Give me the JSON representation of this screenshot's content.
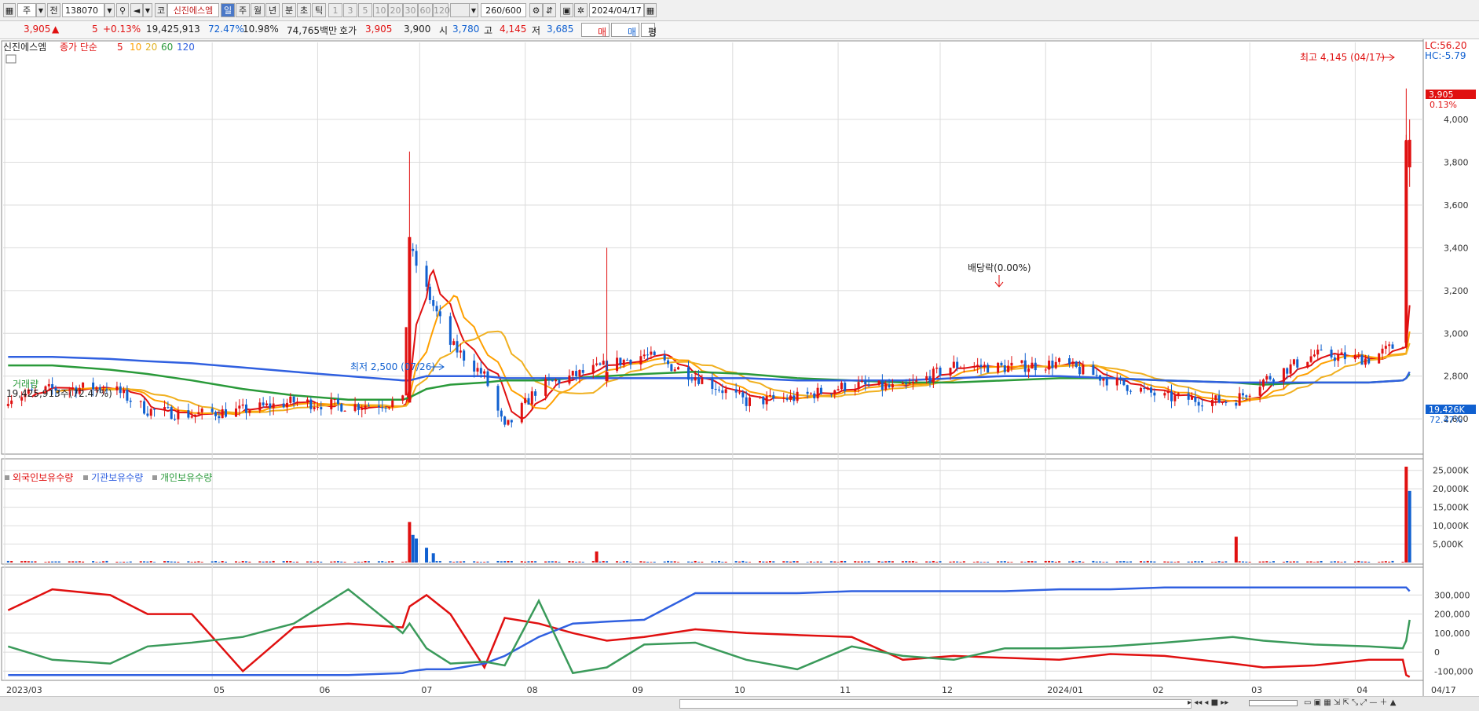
{
  "toolbar": {
    "market_label": "주",
    "prefix_label": "전",
    "code_value": "138070",
    "company_prefix": "코",
    "company_name": "신진에스엠",
    "periods": [
      "일",
      "주",
      "월",
      "년",
      "분",
      "초",
      "틱"
    ],
    "intervals": [
      "1",
      "3",
      "5",
      "10",
      "20",
      "30",
      "60",
      "120"
    ],
    "count_value": "260",
    "count_total": "/600",
    "date_value": "2024/04/17"
  },
  "quote": {
    "price": "3,905",
    "change": "5",
    "change_pct": "+0.13%",
    "volume": "19,425,913",
    "vol_ratio": "72.47%",
    "turnover": "10.98%",
    "amount": "74,765백만",
    "ask_label": "호가",
    "ask_value": "3,905",
    "bid_value": "3,900",
    "open_label": "시",
    "open_value": "3,780",
    "high_label": "고",
    "high_value": "4,145",
    "low_label": "저",
    "low_value": "3,685",
    "buy_label": "매수",
    "sell_label": "매도",
    "extra_label": "평"
  },
  "colors": {
    "up": "#e01010",
    "down": "#1060d0",
    "ma5": "#e01010",
    "ma10": "#ffa000",
    "ma20": "#f0b020",
    "ma60": "#2a9a3a",
    "ma120": "#3060e0",
    "foreign": "#e01010",
    "institution": "#3060e0",
    "individual": "#3a9a5a"
  },
  "chart_data": [
    {
      "type": "candlestick",
      "title": "신진에스엠",
      "legend": [
        "종가 단순",
        "5",
        "10",
        "20",
        "60",
        "120"
      ],
      "ylim": [
        2450,
        4250
      ],
      "y_ticks": [
        "4,000",
        "3,800",
        "3,600",
        "3,400",
        "3,200",
        "3,000",
        "2,800",
        "2,600"
      ],
      "x_ticks": [
        "2023/03",
        "05",
        "06",
        "07",
        "08",
        "09",
        "10",
        "11",
        "12",
        "2024/01",
        "02",
        "03",
        "04",
        "04/17"
      ],
      "last_price_label": "3,905",
      "last_pct_label": "0.13%",
      "lc_label": "LC:56.20",
      "hc_label": "HC:-5.79",
      "high_annotation": "최고 4,145 (04/17)",
      "low_annotation": "최저 2,500 (07/26)",
      "dividend_annotation": "배당락(0.00%)",
      "close_series": [
        {
          "x": "2023-03-02",
          "close": 2700
        },
        {
          "x": "2023-03-15",
          "close": 2740
        },
        {
          "x": "2023-04-01",
          "close": 2750
        },
        {
          "x": "2023-04-12",
          "close": 2640
        },
        {
          "x": "2023-04-25",
          "close": 2620
        },
        {
          "x": "2023-05-10",
          "close": 2640
        },
        {
          "x": "2023-05-25",
          "close": 2680
        },
        {
          "x": "2023-06-10",
          "close": 2660
        },
        {
          "x": "2023-06-26",
          "close": 2680
        },
        {
          "x": "2023-06-28",
          "close": 3400
        },
        {
          "x": "2023-07-03",
          "close": 3200
        },
        {
          "x": "2023-07-10",
          "close": 2950
        },
        {
          "x": "2023-07-20",
          "close": 2800
        },
        {
          "x": "2023-07-26",
          "close": 2550
        },
        {
          "x": "2023-08-05",
          "close": 2750
        },
        {
          "x": "2023-08-15",
          "close": 2800
        },
        {
          "x": "2023-08-25",
          "close": 2850
        },
        {
          "x": "2023-09-05",
          "close": 2900
        },
        {
          "x": "2023-09-20",
          "close": 2800
        },
        {
          "x": "2023-10-05",
          "close": 2680
        },
        {
          "x": "2023-10-20",
          "close": 2700
        },
        {
          "x": "2023-11-05",
          "close": 2760
        },
        {
          "x": "2023-11-20",
          "close": 2740
        },
        {
          "x": "2023-12-05",
          "close": 2850
        },
        {
          "x": "2023-12-20",
          "close": 2840
        },
        {
          "x": "2024-01-05",
          "close": 2860
        },
        {
          "x": "2024-01-20",
          "close": 2780
        },
        {
          "x": "2024-02-05",
          "close": 2700
        },
        {
          "x": "2024-02-25",
          "close": 2680
        },
        {
          "x": "2024-03-05",
          "close": 2780
        },
        {
          "x": "2024-03-20",
          "close": 2900
        },
        {
          "x": "2024-04-05",
          "close": 2880
        },
        {
          "x": "2024-04-15",
          "close": 2960
        },
        {
          "x": "2024-04-16",
          "close": 3900
        },
        {
          "x": "2024-04-17",
          "close": 3905
        }
      ],
      "ma120": [
        2890,
        2890,
        2880,
        2870,
        2860,
        2840,
        2820,
        2800,
        2780,
        2780,
        2800,
        2800,
        2800,
        2790,
        2790,
        2790,
        2790,
        2790,
        2790,
        2790,
        2780,
        2780,
        2780,
        2790,
        2800,
        2800,
        2790,
        2780,
        2770,
        2770,
        2770,
        2770,
        2780,
        2790,
        2820
      ],
      "ma60": [
        2850,
        2850,
        2830,
        2810,
        2780,
        2740,
        2710,
        2690,
        2690,
        2700,
        2740,
        2760,
        2770,
        2780,
        2780,
        2790,
        2800,
        2810,
        2820,
        2810,
        2790,
        2780,
        2770,
        2770,
        2780,
        2790,
        2790,
        2780,
        2770,
        2760,
        2770,
        2770,
        2780,
        2790,
        2810
      ]
    },
    {
      "type": "bar",
      "title": "거래량",
      "summary_label": "19,425,913주(72.47%)",
      "ylim": [
        0,
        26000
      ],
      "y_ticks": [
        "25,000K",
        "20,000K",
        "15,000K",
        "10,000K",
        "5,000K"
      ],
      "last_label": "19,426K",
      "last_pct_label": "72.47%",
      "spikes": [
        {
          "x": "2023-06-28",
          "value": 11000,
          "dir": "up"
        },
        {
          "x": "2023-06-29",
          "value": 7500,
          "dir": "down"
        },
        {
          "x": "2023-06-30",
          "value": 6500,
          "dir": "down"
        },
        {
          "x": "2023-07-03",
          "value": 4000,
          "dir": "down"
        },
        {
          "x": "2023-07-05",
          "value": 2500,
          "dir": "down"
        },
        {
          "x": "2023-08-22",
          "value": 3000,
          "dir": "up"
        },
        {
          "x": "2024-02-26",
          "value": 7000,
          "dir": "up"
        },
        {
          "x": "2024-04-16",
          "value": 26000,
          "dir": "up"
        },
        {
          "x": "2024-04-17",
          "value": 19426,
          "dir": "down"
        }
      ]
    },
    {
      "type": "line",
      "legend": [
        "외국인보유수량",
        "기관보유수량",
        "개인보유수량"
      ],
      "ylim": [
        -140000,
        380000
      ],
      "y_ticks": [
        "300,000",
        "200,000",
        "100,000",
        "0",
        "-100,000"
      ],
      "series": [
        {
          "name": "외국인보유수량",
          "values": [
            220000,
            330000,
            300000,
            200000,
            200000,
            -100000,
            130000,
            150000,
            130000,
            240000,
            300000,
            200000,
            -80000,
            180000,
            150000,
            100000,
            60000,
            80000,
            120000,
            100000,
            90000,
            80000,
            -40000,
            -20000,
            -30000,
            -40000,
            -10000,
            -20000,
            -60000,
            -80000,
            -70000,
            -40000,
            -40000,
            -120000,
            -130000
          ]
        },
        {
          "name": "기관보유수량",
          "values": [
            -120000,
            -120000,
            -120000,
            -120000,
            -120000,
            -120000,
            -120000,
            -120000,
            -110000,
            -100000,
            -90000,
            -90000,
            -60000,
            -20000,
            80000,
            150000,
            160000,
            170000,
            310000,
            310000,
            310000,
            320000,
            320000,
            320000,
            320000,
            330000,
            330000,
            340000,
            340000,
            340000,
            340000,
            340000,
            340000,
            340000,
            320000
          ]
        },
        {
          "name": "개인보유수량",
          "values": [
            30000,
            -40000,
            -60000,
            30000,
            50000,
            80000,
            150000,
            330000,
            100000,
            150000,
            20000,
            -60000,
            -50000,
            -70000,
            270000,
            -110000,
            -80000,
            40000,
            50000,
            -40000,
            -90000,
            30000,
            -20000,
            -40000,
            20000,
            20000,
            30000,
            50000,
            80000,
            60000,
            40000,
            30000,
            20000,
            60000,
            170000
          ]
        }
      ]
    }
  ]
}
